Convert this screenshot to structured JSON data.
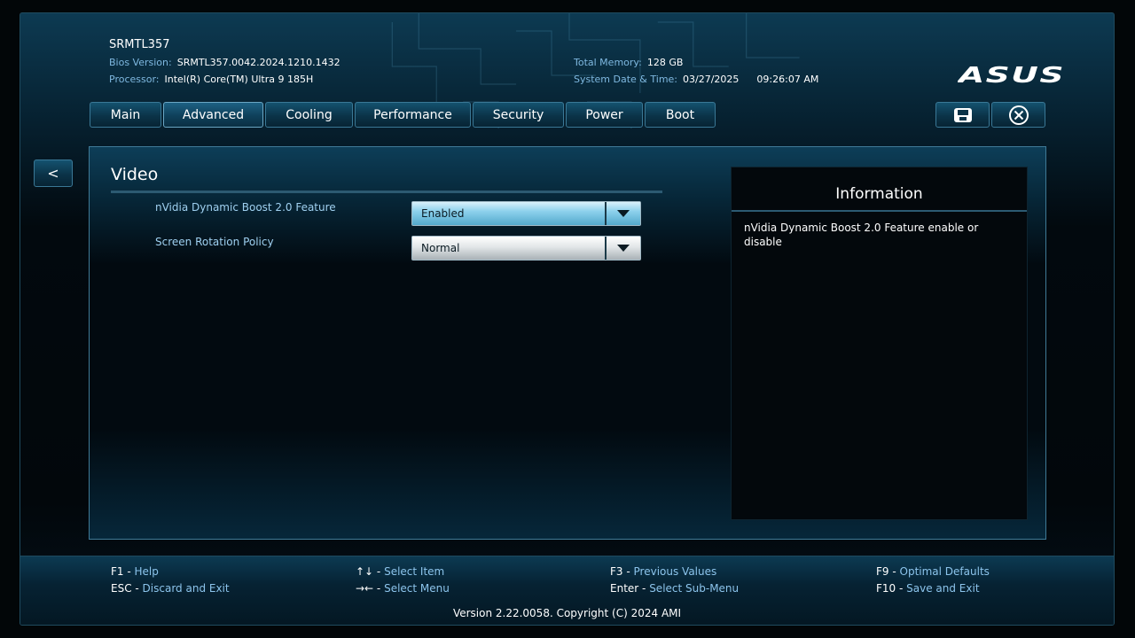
{
  "header": {
    "system_name": "SRMTL357",
    "bios_version_label": "Bios Version:",
    "bios_version": "SRMTL357.0042.2024.1210.1432",
    "processor_label": "Processor:",
    "processor": "Intel(R) Core(TM) Ultra 9 185H",
    "memory_label": "Total Memory:",
    "memory": "128 GB",
    "datetime_label": "System Date & Time:",
    "date": "03/27/2025",
    "time": "09:26:07 AM",
    "logo": "ASUS"
  },
  "tabs": [
    {
      "label": "Main"
    },
    {
      "label": "Advanced",
      "active": true
    },
    {
      "label": "Cooling"
    },
    {
      "label": "Performance"
    },
    {
      "label": "Security"
    },
    {
      "label": "Power"
    },
    {
      "label": "Boot"
    }
  ],
  "toolbar": {
    "save_icon": "save-icon",
    "exit_icon": "close-circle-icon"
  },
  "back_button": {
    "label": "<"
  },
  "section": {
    "title": "Video",
    "settings": [
      {
        "label": "nVidia Dynamic Boost 2.0 Feature",
        "value": "Enabled",
        "highlighted": true
      },
      {
        "label": "Screen Rotation Policy",
        "value": "Normal",
        "highlighted": false
      }
    ]
  },
  "info_panel": {
    "title": "Information",
    "text": "nVidia Dynamic Boost 2.0 Feature enable or disable"
  },
  "footer": {
    "hotkeys": [
      {
        "key": "F1",
        "desc": "Help"
      },
      {
        "key": "ESC",
        "desc": "Discard and Exit"
      },
      {
        "key": "↑↓",
        "desc": "Select Item"
      },
      {
        "key": "→←",
        "desc": "Select Menu"
      },
      {
        "key": "F3",
        "desc": "Previous Values"
      },
      {
        "key": "Enter",
        "desc": "Select Sub-Menu"
      },
      {
        "key": "F9",
        "desc": "Optimal Defaults"
      },
      {
        "key": "F10",
        "desc": "Save and Exit"
      }
    ],
    "version": "Version 2.22.0058. Copyright (C) 2024 AMI"
  },
  "colors": {
    "accent": "#7fb8e0",
    "highlight_select": "#8dd1ec",
    "panel_border": "#3f7a96"
  }
}
